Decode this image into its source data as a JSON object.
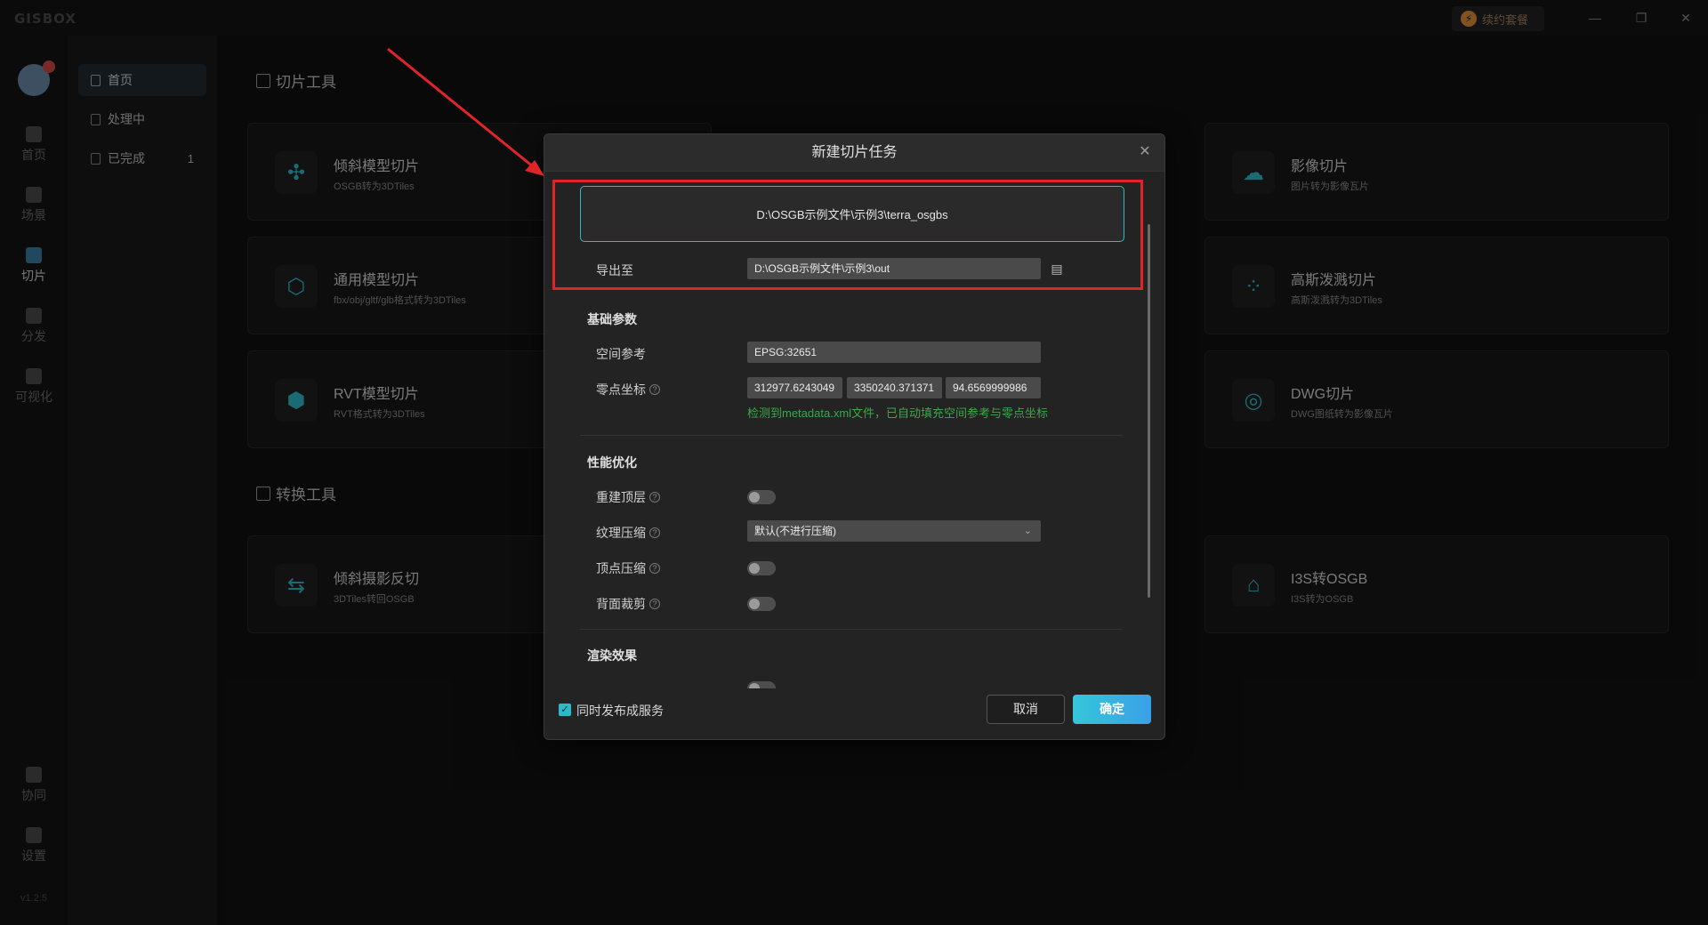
{
  "app": {
    "logo": "GISBOX",
    "plan_button": "续约套餐",
    "version": "v1.2.5"
  },
  "sidebar": {
    "items": [
      {
        "label": "首页",
        "icon": "home-icon"
      },
      {
        "label": "场景",
        "icon": "cube-icon"
      },
      {
        "label": "切片",
        "icon": "slice-icon"
      },
      {
        "label": "分发",
        "icon": "share-icon"
      },
      {
        "label": "可视化",
        "icon": "chart-icon"
      },
      {
        "label": "协同",
        "icon": "lock-icon"
      },
      {
        "label": "设置",
        "icon": "gear-icon"
      }
    ]
  },
  "subnav": {
    "items": [
      {
        "label": "首页"
      },
      {
        "label": "处理中"
      },
      {
        "label": "已完成",
        "count": "1"
      }
    ]
  },
  "main": {
    "slice_section": "切片工具",
    "convert_section": "转换工具",
    "cards": [
      {
        "title": "倾斜模型切片",
        "subtitle": "OSGB转为3DTiles"
      },
      {
        "title": "影像切片",
        "subtitle": "图片转为影像瓦片"
      },
      {
        "title": "通用模型切片",
        "subtitle": "fbx/obj/gltf/glb格式转为3DTiles"
      },
      {
        "title": "高斯泼溅切片",
        "subtitle": "高斯泼溅转为3DTiles"
      },
      {
        "title": "RVT模型切片",
        "subtitle": "RVT格式转为3DTiles"
      },
      {
        "title": "DWG切片",
        "subtitle": "DWG图纸转为影像瓦片"
      },
      {
        "title": "倾斜摄影反切",
        "subtitle": "3DTiles转回OSGB"
      },
      {
        "title": "I3S转OSGB",
        "subtitle": "I3S转为OSGB"
      }
    ]
  },
  "modal": {
    "title": "新建切片任务",
    "input_path": "D:\\OSGB示例文件\\示例3\\terra_osgbs",
    "export_label": "导出至",
    "export_path": "D:\\OSGB示例文件\\示例3\\out",
    "basic_group": "基础参数",
    "srs_label": "空间参考",
    "srs_value": "EPSG:32651",
    "origin_label": "零点坐标",
    "origin_x": "312977.6243049",
    "origin_y": "3350240.371371",
    "origin_z": "94.6569999986",
    "hint": "检测到metadata.xml文件，已自动填充空间参考与零点坐标",
    "perf_group": "性能优化",
    "rebuild_top_label": "重建顶层",
    "texture_label": "纹理压缩",
    "texture_value": "默认(不进行压缩)",
    "vertex_label": "顶点压缩",
    "backface_label": "背面裁剪",
    "render_group": "渲染效果",
    "publish_label": "同时发布成服务",
    "cancel_label": "取消",
    "ok_label": "确定"
  },
  "colors": {
    "accent": "#2fb8c8",
    "highlight": "#e0242a",
    "hint": "#3aa84a"
  }
}
